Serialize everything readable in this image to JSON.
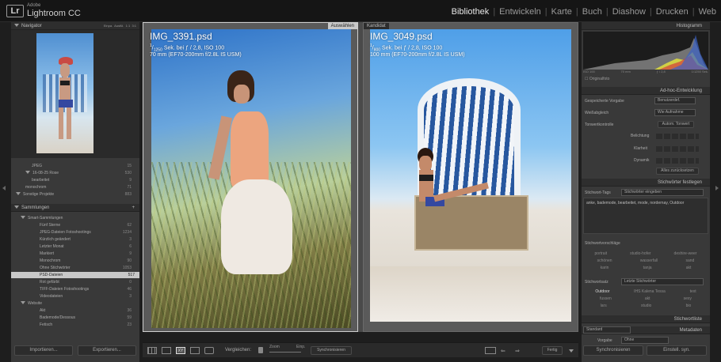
{
  "app": {
    "adobe": "Adobe",
    "name": "Lightroom CC",
    "logo": "Lr"
  },
  "modules": [
    {
      "label": "Bibliothek",
      "active": true
    },
    {
      "label": "Entwickeln"
    },
    {
      "label": "Karte"
    },
    {
      "label": "Buch"
    },
    {
      "label": "Diashow"
    },
    {
      "label": "Drucken"
    },
    {
      "label": "Web"
    }
  ],
  "navigator": {
    "title": "Navigator",
    "opts": [
      "Einpa.",
      "Ausfül.",
      "1:1",
      "3:1"
    ]
  },
  "folders": [
    {
      "label": "JPEG",
      "count": "15"
    },
    {
      "label": "16-08-25 Rose",
      "count": "530"
    },
    {
      "label": "bearbeitet",
      "count": "9"
    },
    {
      "label": "monochrom",
      "count": "71"
    },
    {
      "label": "Sonstige Projekte",
      "count": "883"
    }
  ],
  "collections": {
    "title": "Sammlungen",
    "items": [
      {
        "label": "Smart-Sammlungen",
        "count": ""
      },
      {
        "label": "Fünf Sterne",
        "count": "62"
      },
      {
        "label": "JPEG-Dateien Fotoshootings",
        "count": "1234"
      },
      {
        "label": "Kürzlich geändert",
        "count": "3"
      },
      {
        "label": "Letzter Monat",
        "count": "6"
      },
      {
        "label": "Markiert",
        "count": "9"
      },
      {
        "label": "Monochrom",
        "count": "90"
      },
      {
        "label": "Ohne Stichwörter",
        "count": "1053"
      },
      {
        "label": "PSD-Dateien",
        "count": "517"
      },
      {
        "label": "Rot gefärbt",
        "count": "0"
      },
      {
        "label": "TIFF-Dateien Fotoshootings",
        "count": "46"
      },
      {
        "label": "Videodateien",
        "count": "3"
      },
      {
        "label": "Website",
        "count": ""
      },
      {
        "label": "Akt",
        "count": "36"
      },
      {
        "label": "Bademode/Dessous",
        "count": "59"
      },
      {
        "label": "Fetisch",
        "count": "23"
      }
    ]
  },
  "left_buttons": {
    "import": "Importieren...",
    "export": "Exportieren..."
  },
  "select": {
    "tag": "Auswählen",
    "file": "IMG_3391.psd",
    "shutter_num": "1",
    "shutter_den": "1250",
    "exp_rest": "Sek. bei ƒ / 2,8, ISO 100",
    "lens": "70 mm (EF70-200mm f/2.8L IS USM)"
  },
  "candidate": {
    "tag": "Kandidat",
    "file": "IMG_3049.psd",
    "shutter_num": "1",
    "shutter_den": "800",
    "exp_rest": "Sek. bei ƒ / 2,8, ISO 100",
    "lens": "100 mm (EF70-200mm f/2.8L IS USM)"
  },
  "toolbar": {
    "compare": "Vergleichen:",
    "zoom": "Zoom",
    "fit": "Einp.",
    "sync": "Synchronisieren",
    "done": "Fertig"
  },
  "histogram": {
    "title": "Histogramm",
    "iso": "ISO 100",
    "focal": "70 mm",
    "aperture": "ƒ / 2,8",
    "shutter": "1/1250 Sek.",
    "original": "Originalfoto"
  },
  "quick_develop": {
    "title": "Ad-hoc-Entwicklung",
    "preset_label": "Gespeicherte Vorgabe",
    "preset_value": "Benutzerdef.",
    "wb_label": "Weißabgleich",
    "wb_value": "Wie Aufnahme",
    "tone_label": "Tonwertkontrolle",
    "auto": "Autom. Tonwert",
    "exposure": "Belichtung",
    "clarity": "Klarheit",
    "vibrance": "Dynamik",
    "reset": "Alles zurücksetzen"
  },
  "keywording": {
    "title": "Stichwörter festlegen",
    "tags_label": "Stichwort-Tags",
    "tags_value": "Stichwörter eingeben",
    "keywords": "anke, bademode, bearbeitet, mode, nordernay, Outdoor",
    "sugg_label": "Stichwortvorschläge",
    "sugg": [
      [
        "portrait",
        "studio-hofer",
        "deshire-weer"
      ],
      [
        "schönen",
        "wasserfall",
        "sand"
      ],
      [
        "karin",
        "tanja",
        "akt"
      ]
    ],
    "set_label": "Stichwortsatz",
    "set_value": "Letzte Stichwörter",
    "set": [
      [
        "Outdoor",
        "IHS Kalena Tessa",
        "text"
      ],
      [
        "fussen",
        "akt",
        "sexy"
      ],
      [
        "lars",
        "studio",
        "bio"
      ]
    ]
  },
  "keyword_list": {
    "title": "Stichwortliste"
  },
  "metadata": {
    "title": "Metadaten",
    "preset": "Standard",
    "vorgabe": "Vorgabe",
    "ohne": "Ohne"
  },
  "right_buttons": {
    "sync": "Synchronisieren",
    "settings": "Einstell. syn."
  }
}
